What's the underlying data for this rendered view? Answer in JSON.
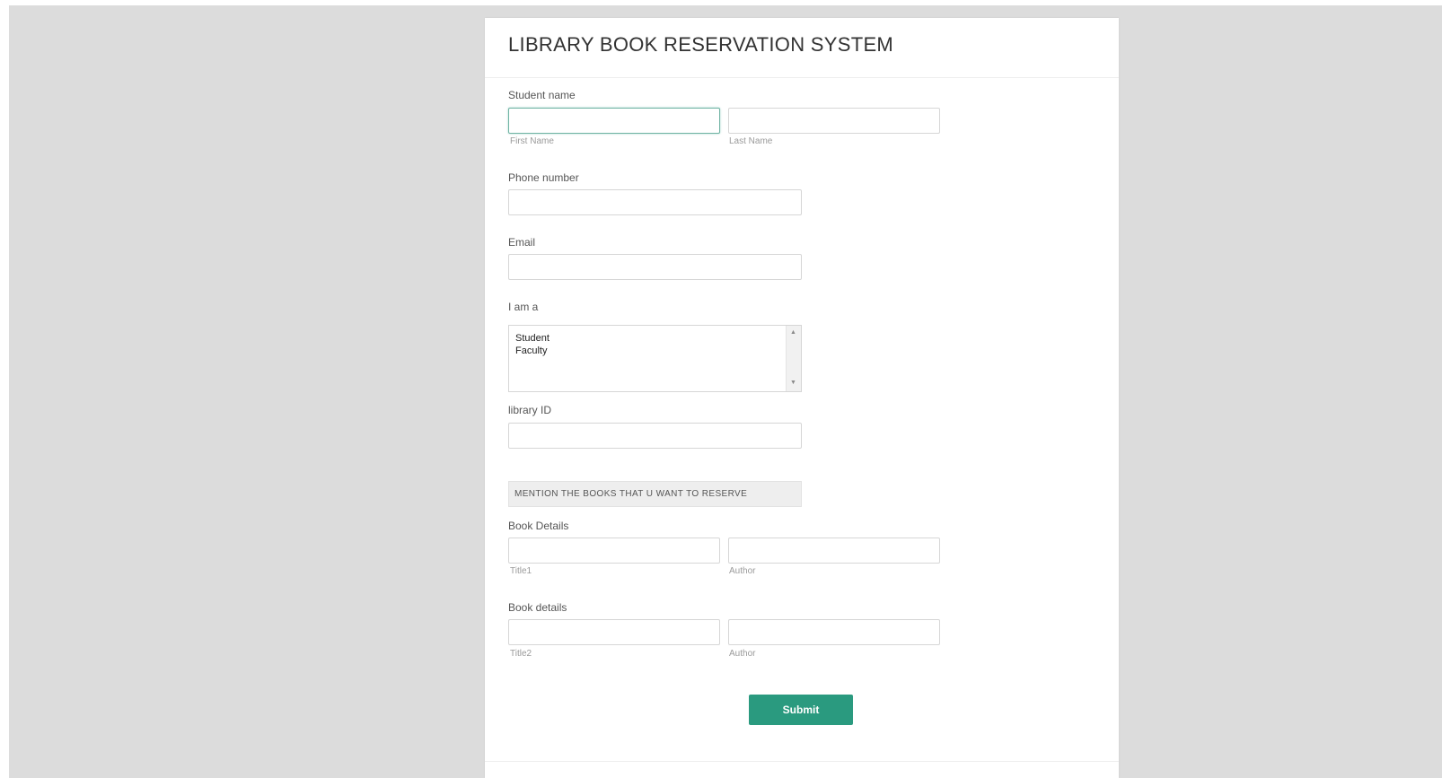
{
  "form": {
    "title": "LIBRARY BOOK RESERVATION SYSTEM",
    "student_name": {
      "label": "Student name",
      "first_sublabel": "First Name",
      "last_sublabel": "Last Name",
      "first_value": "",
      "last_value": ""
    },
    "phone": {
      "label": "Phone number",
      "value": ""
    },
    "email": {
      "label": "Email",
      "value": ""
    },
    "role": {
      "label": "I am a",
      "options": [
        "Student",
        "Faculty"
      ]
    },
    "library_id": {
      "label": "library ID",
      "value": ""
    },
    "notice": "MENTION THE BOOKS THAT U WANT TO RESERVE",
    "book1": {
      "label": "Book Details",
      "title_sublabel": "Title1",
      "author_sublabel": "Author"
    },
    "book2": {
      "label": "Book details",
      "title_sublabel": "Title2",
      "author_sublabel": "Author"
    },
    "submit_label": "Submit"
  },
  "colors": {
    "accent": "#2a9a7f",
    "background": "#dcdcdc",
    "card": "#ffffff"
  },
  "icons": {
    "scroll_up": "scroll-up-arrow-icon",
    "scroll_down": "scroll-down-arrow-icon"
  }
}
